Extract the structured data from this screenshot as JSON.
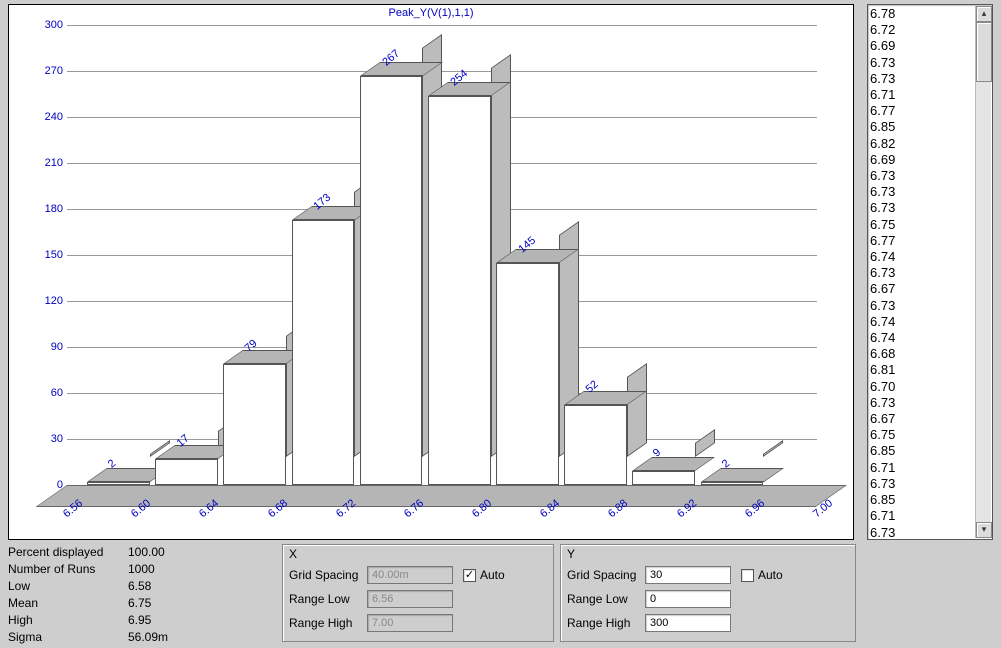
{
  "chart_data": {
    "type": "bar",
    "title": "Peak_Y(V(1),1,1)",
    "categories": [
      "6.56",
      "6.60",
      "6.64",
      "6.68",
      "6.72",
      "6.76",
      "6.80",
      "6.84",
      "6.88",
      "6.92",
      "6.96",
      "7.00"
    ],
    "values": [
      2,
      17,
      79,
      173,
      267,
      254,
      145,
      52,
      9,
      2,
      0
    ],
    "y_ticks": [
      0,
      30,
      60,
      90,
      120,
      150,
      180,
      210,
      240,
      270,
      300
    ],
    "xlabel": "",
    "ylabel": "",
    "ylim": [
      0,
      300
    ]
  },
  "stats": {
    "percent_displayed_label": "Percent displayed",
    "percent_displayed_value": "100.00",
    "num_runs_label": "Number of Runs",
    "num_runs_value": "1000",
    "low_label": "Low",
    "low_value": "6.58",
    "mean_label": "Mean",
    "mean_value": "6.75",
    "high_label": "High",
    "high_value": "6.95",
    "sigma_label": "Sigma",
    "sigma_value": "56.09m"
  },
  "panel_x": {
    "title": "X",
    "grid_spacing_label": "Grid Spacing",
    "grid_spacing_value": "40.00m",
    "range_low_label": "Range Low",
    "range_low_value": "6.56",
    "range_high_label": "Range High",
    "range_high_value": "7.00",
    "auto_label": "Auto",
    "auto_checked": true
  },
  "panel_y": {
    "title": "Y",
    "grid_spacing_label": "Grid Spacing",
    "grid_spacing_value": "30",
    "range_low_label": "Range Low",
    "range_low_value": "0",
    "range_high_label": "Range High",
    "range_high_value": "300",
    "auto_label": "Auto",
    "auto_checked": false
  },
  "list_values": [
    "6.78",
    "6.72",
    "6.69",
    "6.73",
    "6.73",
    "6.71",
    "6.77",
    "6.85",
    "6.82",
    "6.69",
    "6.73",
    "6.73",
    "6.73",
    "6.75",
    "6.77",
    "6.74",
    "6.73",
    "6.67",
    "6.73",
    "6.74",
    "6.74",
    "6.68",
    "6.81",
    "6.70",
    "6.73",
    "6.67",
    "6.75",
    "6.85",
    "6.71",
    "6.73",
    "6.85",
    "6.71",
    "6.73"
  ]
}
